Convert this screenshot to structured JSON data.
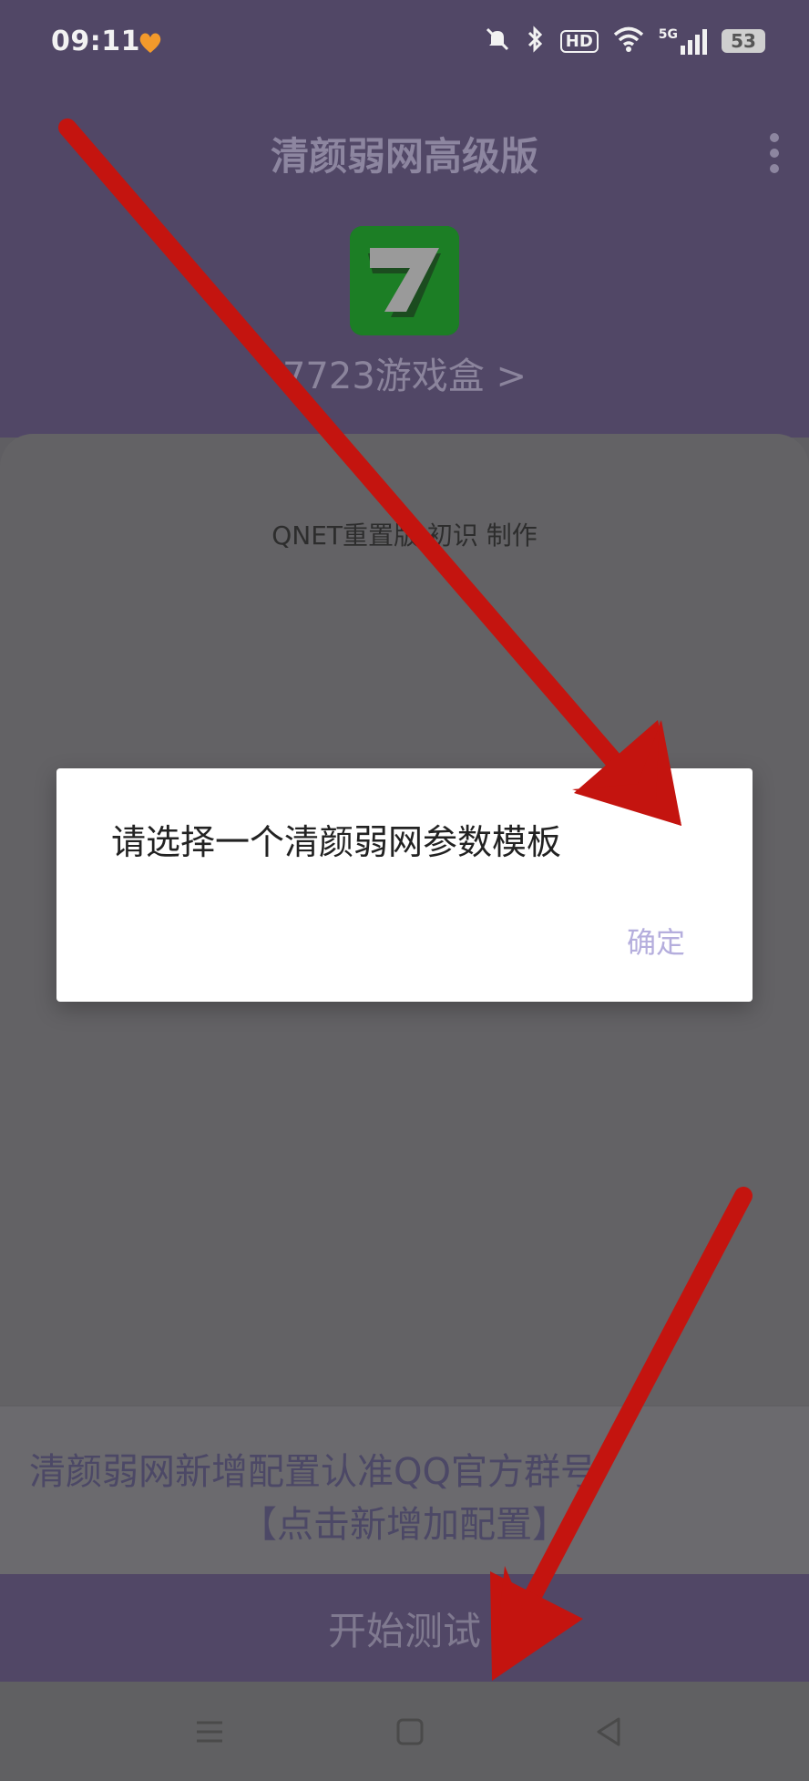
{
  "status_bar": {
    "time": "09:11",
    "hd_label": "HD",
    "network_label": "5G",
    "battery": "53",
    "icons": [
      "heart-app-icon",
      "mute-icon",
      "bluetooth-icon",
      "hd-icon",
      "wifi-icon",
      "signal-icon",
      "battery-icon"
    ]
  },
  "header": {
    "title": "清颜弱网高级版"
  },
  "app": {
    "name": "7723游戏盒 >",
    "icon_letter": "7"
  },
  "card": {
    "credit": "QNET重置版 初识 制作"
  },
  "dialog": {
    "message": "请选择一个清颜弱网参数模板",
    "ok_label": "确定"
  },
  "banner": {
    "line1": "清颜弱网新增配置认准QQ官方群号",
    "line2": "【点击新增加配置】"
  },
  "start_button": {
    "label": "开始测试"
  },
  "nav": {
    "icons": [
      "menu-icon",
      "home-icon",
      "back-icon"
    ]
  },
  "annotation": {
    "color": "#c4140f"
  }
}
